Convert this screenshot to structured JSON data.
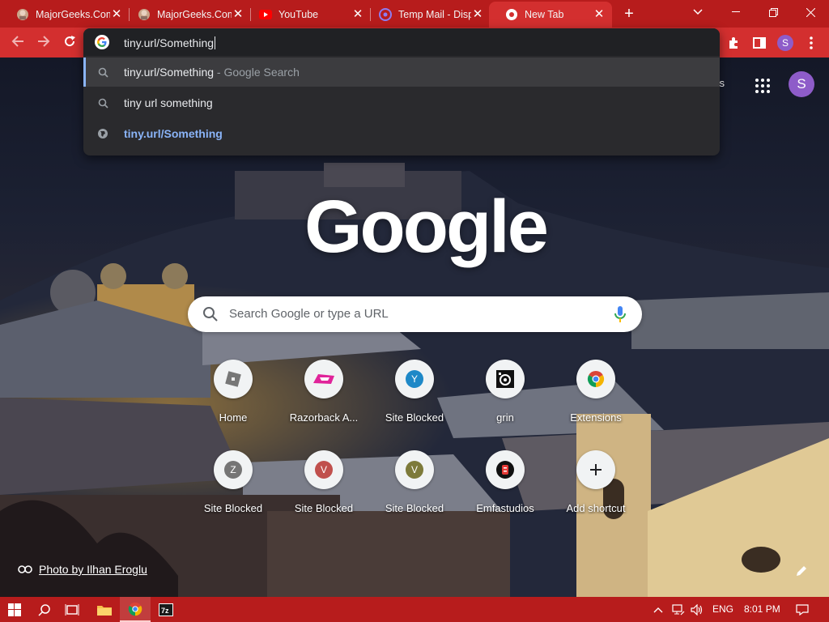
{
  "browser": {
    "tabs": [
      {
        "title": "MajorGeeks.Com",
        "favicon": "majorgeeks-icon",
        "active": false
      },
      {
        "title": "MajorGeeks.Com",
        "favicon": "majorgeeks-icon",
        "active": false
      },
      {
        "title": "YouTube",
        "favicon": "youtube-icon",
        "active": false
      },
      {
        "title": "Temp Mail - Disposable",
        "favicon": "tempmail-icon",
        "active": false
      },
      {
        "title": "New Tab",
        "favicon": "chrome-icon",
        "active": true
      }
    ],
    "omnibox": {
      "value": "tiny.url/Something",
      "suggestions": [
        {
          "text": "tiny.url/Something",
          "sub": " - Google Search",
          "icon": "search-icon",
          "selected": true
        },
        {
          "text": "tiny url something",
          "sub": "",
          "icon": "search-icon",
          "selected": false
        },
        {
          "text": "tiny.url/Something",
          "sub": "",
          "icon": "globe-icon",
          "selected": false
        }
      ]
    },
    "profile_initial": "S"
  },
  "ntp": {
    "images_link": "ges",
    "logo": "Google",
    "search_placeholder": "Search Google or type a URL",
    "shortcuts": [
      {
        "label": "Home",
        "icon": "roblox-icon"
      },
      {
        "label": "Razorback A...",
        "icon": "razorback-icon"
      },
      {
        "label": "Site Blocked",
        "icon": "letter-y-icon",
        "letter": "Y",
        "color": "#1e88c7"
      },
      {
        "label": "grin",
        "icon": "grin-icon"
      },
      {
        "label": "Extensions",
        "icon": "chrome-icon"
      },
      {
        "label": "Site Blocked",
        "icon": "letter-z-icon",
        "letter": "Z",
        "color": "#757575"
      },
      {
        "label": "Site Blocked",
        "icon": "letter-v-icon",
        "letter": "V",
        "color": "#c0504d"
      },
      {
        "label": "Site Blocked",
        "icon": "letter-v-icon",
        "letter": "V",
        "color": "#7d7a3a"
      },
      {
        "label": "Emfastudios",
        "icon": "emfa-icon"
      },
      {
        "label": "Add shortcut",
        "icon": "plus-icon"
      }
    ],
    "photo_credit": "Photo by Ilhan Eroglu",
    "avatar_initial": "S"
  },
  "taskbar": {
    "language": "ENG",
    "time": "8:01 PM"
  },
  "colors": {
    "accent": "#d32f2f",
    "tabstrip": "#b71c1c",
    "omnibox_bg": "#2a2a2d",
    "link_blue": "#8ab4f8"
  }
}
